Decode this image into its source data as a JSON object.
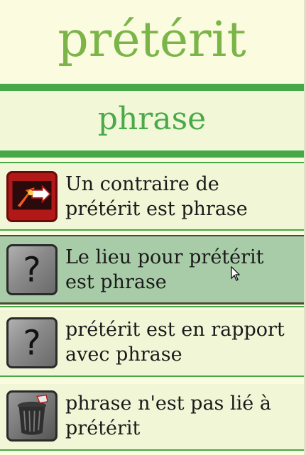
{
  "header": {
    "title": "prétérit"
  },
  "subheader": {
    "word": "phrase"
  },
  "cards": [
    {
      "text": "Un contraire de prétérit est phrase",
      "icon": "antonym-arrows-icon"
    },
    {
      "text": "Le lieu pour prétérit est phrase",
      "icon": "question-mark-icon"
    },
    {
      "text": "prétérit est en rapport avec phrase",
      "icon": "question-mark-icon"
    },
    {
      "text": "phrase n'est pas lié à prétérit",
      "icon": "trash-can-icon"
    }
  ],
  "colors": {
    "background": "#fafbdf",
    "accent_green": "#46a846",
    "title_green": "#7bb548",
    "selected_card": "#a8cca8"
  }
}
